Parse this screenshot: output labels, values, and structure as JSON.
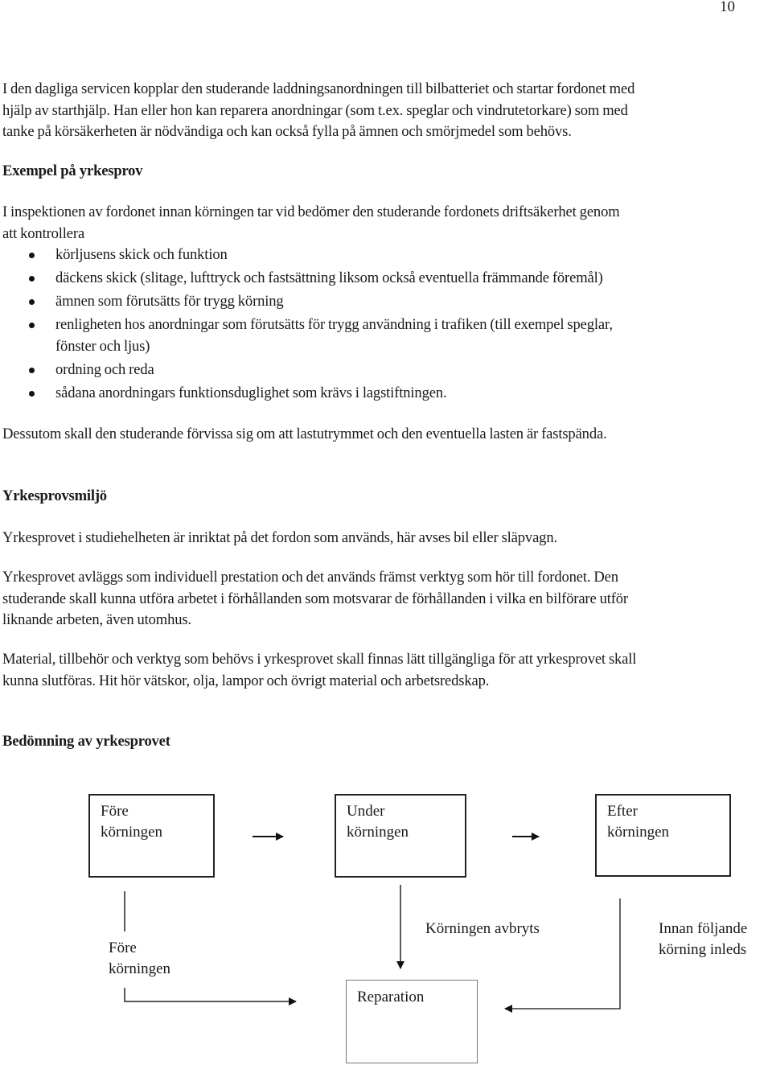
{
  "page_number": "10",
  "intro_paragraph": {
    "lines": [
      "I den dagliga servicen kopplar den studerande laddningsanordningen till bilbatteriet och startar fordonet med",
      "hjälp av starthjälp. Han eller hon kan reparera anordningar (som t.ex. speglar och vindrutetorkare) som med",
      "tanke på körsäkerheten är nödvändiga och kan också fylla på ämnen och smörjmedel som behövs."
    ]
  },
  "section_example": {
    "heading": "Exempel på yrkesprov",
    "intro_lines": [
      "I inspektionen av fordonet innan körningen tar vid bedömer den studerande fordonets driftsäkerhet genom",
      "att kontrollera"
    ],
    "bullets": [
      [
        "körljusens skick och funktion"
      ],
      [
        "däckens skick (slitage, lufttryck och fastsättning liksom också eventuella främmande föremål)"
      ],
      [
        "ämnen som förutsätts för trygg körning"
      ],
      [
        "renligheten hos anordningar som förutsätts för trygg användning i trafiken (till exempel speglar,",
        "fönster och ljus)"
      ],
      [
        "ordning och reda"
      ],
      [
        "sådana anordningars funktionsduglighet som krävs i lagstiftningen."
      ]
    ],
    "closing": "Dessutom skall den studerande förvissa sig om att lastutrymmet och den eventuella lasten är fastspända."
  },
  "section_environment": {
    "heading": "Yrkesprovsmiljö",
    "paragraph1": "Yrkesprovet i studiehelheten är inriktat på det fordon som används, här avses bil eller släpvagn.",
    "paragraph2_lines": [
      "Yrkesprovet avläggs som individuell prestation och det används främst verktyg som hör till fordonet. Den",
      "studerande skall kunna utföra arbetet i förhållanden som motsvarar de förhållanden i vilka en bilförare utför",
      "liknande arbeten, även utomhus."
    ],
    "paragraph3_lines": [
      "Material, tillbehör och verktyg som behövs i yrkesprovet skall finnas lätt tillgängliga för att yrkesprovet skall",
      "kunna slutföras. Hit hör vätskor, olja, lampor och övrigt material och arbetsredskap."
    ]
  },
  "section_assessment": {
    "heading": "Bedömning av yrkesprovet"
  },
  "diagram": {
    "boxes": [
      {
        "id": "before",
        "lines": [
          "Före",
          "körningen"
        ]
      },
      {
        "id": "during",
        "lines": [
          "Under",
          "körningen"
        ]
      },
      {
        "id": "after",
        "lines": [
          "Efter",
          "körningen"
        ]
      },
      {
        "id": "repair",
        "lines": [
          "Reparation"
        ]
      }
    ],
    "labels": {
      "before_lower": [
        "Före",
        "körningen"
      ],
      "interrupted": [
        "Körningen avbryts"
      ],
      "before_next": [
        "Innan följande",
        "körning inleds"
      ]
    },
    "arrows": [
      {
        "from": "before",
        "to": "during",
        "direction": "right"
      },
      {
        "from": "during",
        "to": "after",
        "direction": "right"
      },
      {
        "from": "during",
        "to": "repair",
        "direction": "down",
        "label": "Körningen avbryts"
      },
      {
        "from": "before",
        "to": "repair",
        "direction": "right",
        "label": "Före körningen"
      },
      {
        "from": "after",
        "to": "repair",
        "direction": "left",
        "label": "Innan följande körning inleds"
      }
    ]
  }
}
